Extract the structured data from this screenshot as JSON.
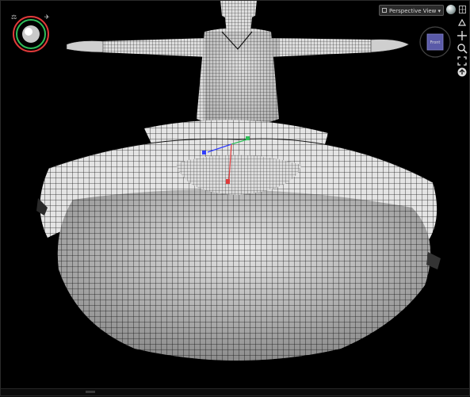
{
  "viewport": {
    "view_menu_label": "Perspective View",
    "cube_face_label": "Front",
    "accent_colors": {
      "compass_green": "#2fbf5a",
      "compass_red": "#e03a3a",
      "gizmo_blue": "#2f3cff",
      "cube_face": "#5a5aa8",
      "mesh_fill": "#d9d9d9",
      "mesh_wire": "#1a1a1a"
    }
  },
  "toolbar": {
    "icons": [
      "perspective-icon",
      "pan-icon",
      "zoom-icon",
      "fit-icon",
      "frame-icon",
      "home-icon",
      "grid-icon"
    ]
  }
}
